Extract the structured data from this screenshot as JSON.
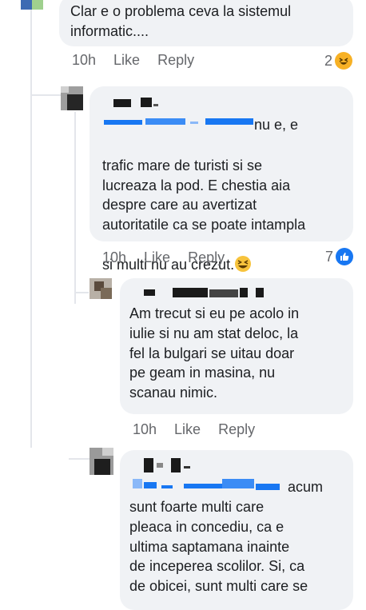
{
  "comments": [
    {
      "text": "Clar e o problema ceva la sistemul\ninformatic....",
      "time": "10h",
      "like": "Like",
      "reply": "Reply",
      "reaction_count": "2",
      "reaction_icon": "haha-icon"
    },
    {
      "text_tail": "nu e, e",
      "text": "trafic mare de turisti si se\nlucreaza la pod. E chestia aia\ndespre care au avertizat\nautoritatile ca se poate intampla\nsi multi nu au crezut.",
      "time": "10h",
      "like": "Like",
      "reply": "Reply",
      "reaction_count": "7",
      "reaction_icon": "like-icon"
    },
    {
      "text": "Am trecut si eu pe acolo in\niulie si nu am stat deloc, la\nfel la bulgari se uitau doar\npe geam in masina, nu\nscanau nimic.",
      "time": "10h",
      "like": "Like",
      "reply": "Reply"
    },
    {
      "text_tail": "acum",
      "text": "sunt foarte multi care\npleaca in concediu, ca e\nultima saptamana inainte\nde inceperea scolilor. Si, ca\nde obicei, sunt multi care se"
    }
  ],
  "colors": {
    "bubble": "#f0f2f5",
    "meta": "#65676b",
    "like_blue": "#1877f2",
    "haha_yellow": "#f7b125",
    "link_blue": "#1877f2"
  }
}
